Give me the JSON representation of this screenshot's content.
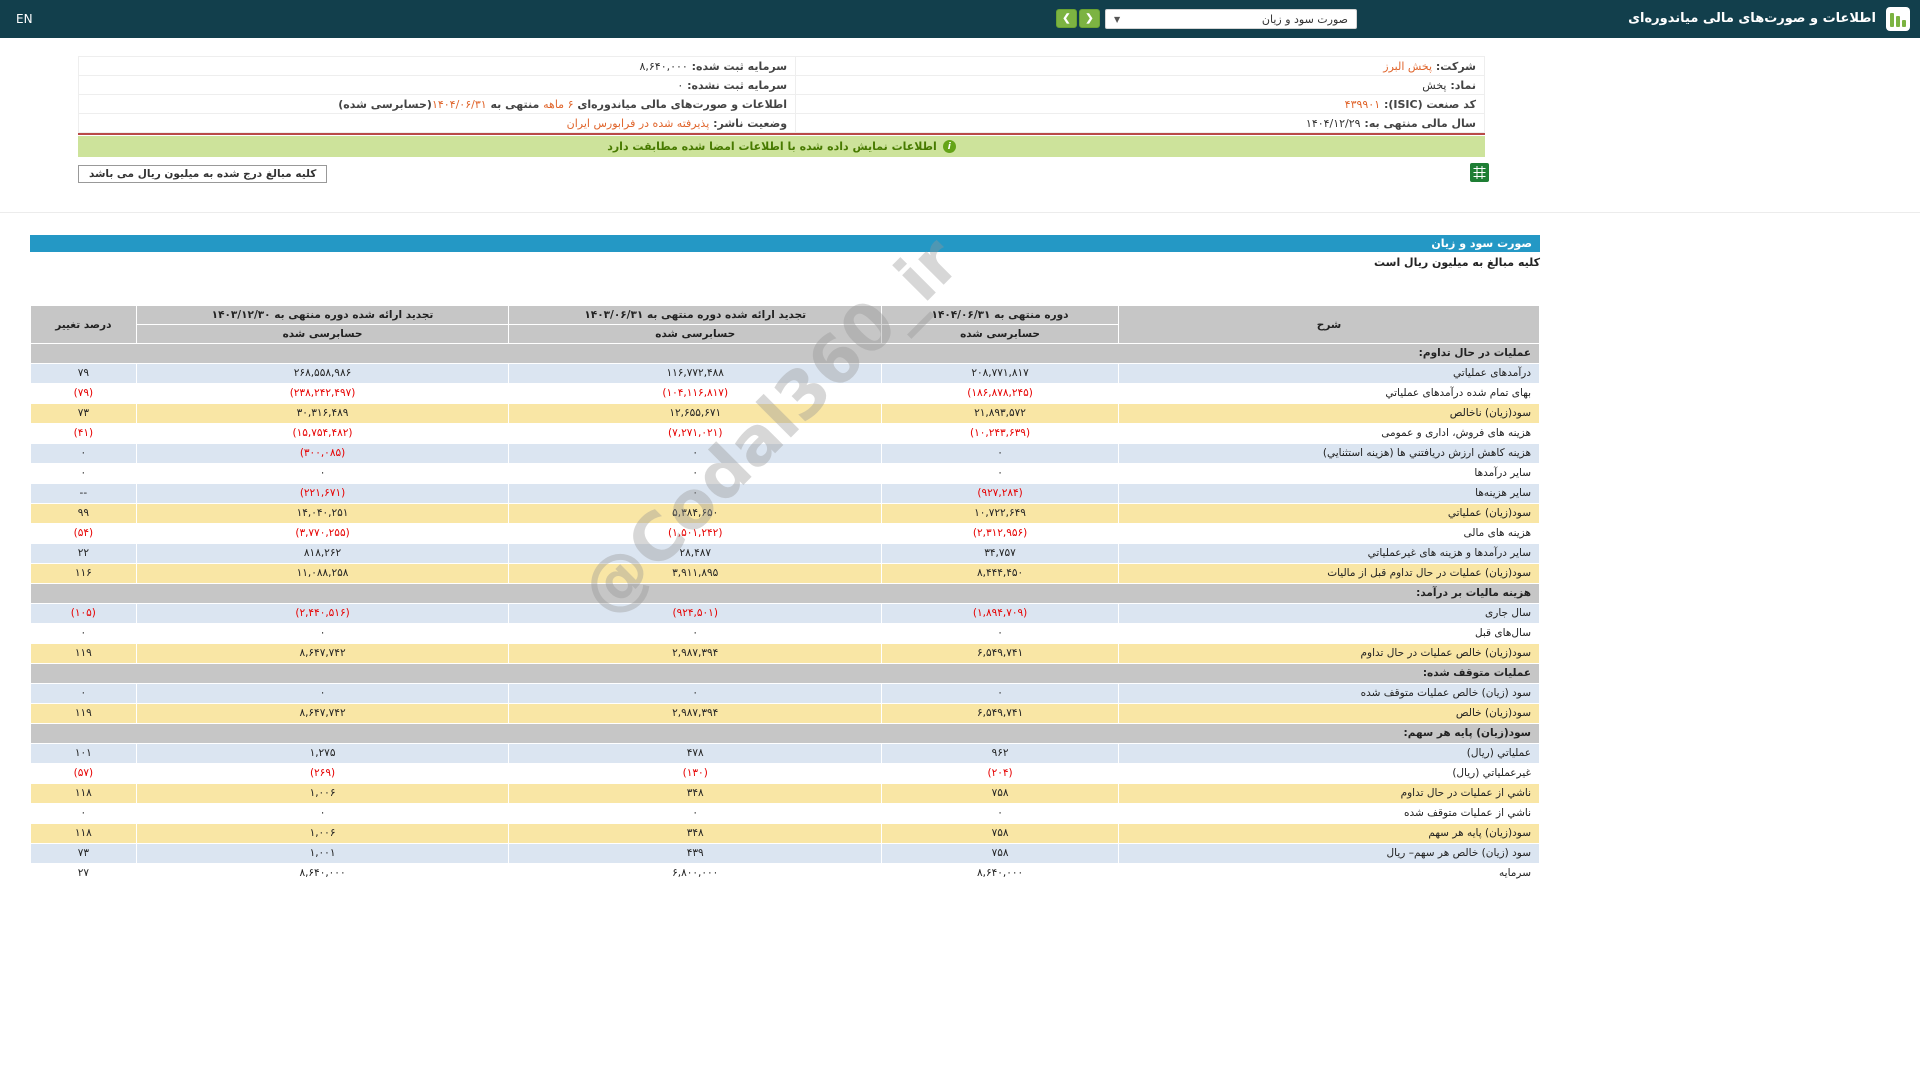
{
  "topbar": {
    "title": "اطلاعات و صورت‌های مالی میاندوره‌ای",
    "dropdown_value": "صورت سود و زیان",
    "prev_label": "❮",
    "next_label": "❯",
    "en_label": "EN"
  },
  "company": {
    "rows": [
      {
        "right": [
          {
            "t": "شرکت:  ",
            "c": "label"
          },
          {
            "t": "پخش البرز",
            "c": "orange",
            "link": true
          }
        ],
        "left": [
          {
            "t": "سرمایه ثبت شده:  ",
            "c": "label"
          },
          {
            "t": "۸,۶۴۰,۰۰۰",
            "c": "dark"
          }
        ]
      },
      {
        "right": [
          {
            "t": "نماد:  ",
            "c": "label"
          },
          {
            "t": "پخش",
            "c": "dark"
          }
        ],
        "left": [
          {
            "t": "سرمایه ثبت نشده:  ",
            "c": "label"
          },
          {
            "t": "۰",
            "c": "dark"
          }
        ]
      },
      {
        "right": [
          {
            "t": "کد صنعت (ISIC):  ",
            "c": "label"
          },
          {
            "t": "۴۳۹۹۰۱",
            "c": "orange"
          }
        ],
        "left": [
          {
            "t": "اطلاعات و صورت‌های مالی میاندوره‌ای ",
            "c": "label"
          },
          {
            "t": "۶ ماهه",
            "c": "orange"
          },
          {
            "t": " منتهی به ",
            "c": "label"
          },
          {
            "t": "۱۴۰۴/۰۶/۳۱",
            "c": "orange"
          },
          {
            "t": "(حسابرسی شده)",
            "c": "label"
          }
        ]
      },
      {
        "right": [
          {
            "t": "سال مالی منتهی به:  ",
            "c": "label"
          },
          {
            "t": "۱۴۰۴/۱۲/۲۹",
            "c": "dark"
          }
        ],
        "left": [
          {
            "t": "وضعیت ناشر:  ",
            "c": "label"
          },
          {
            "t": "پذیرفته شده در فرابورس ایران",
            "c": "orange"
          }
        ]
      }
    ]
  },
  "banner": {
    "icon_glyph": "i",
    "text": "اطلاعات نمایش داده شده با اطلاعات امضا شده مطابقت دارد"
  },
  "amounts_note": "کلیه مبالغ درج شده به میلیون ریال می باشد",
  "statement": {
    "title": "صورت سود و زیان",
    "note": "کلیه مبالغ به میلیون ریال است",
    "header": {
      "desc": "شرح",
      "chg": "درصد تغییر",
      "periods": [
        {
          "title": "دوره منتهی به ۱۴۰۴/۰۶/۳۱",
          "sub": "حسابرسی شده"
        },
        {
          "title": "تجدید ارائه شده دوره منتهی به ۱۴۰۳/۰۶/۳۱",
          "sub": "حسابرسی شده"
        },
        {
          "title": "تجدید ارائه شده دوره منتهی به ۱۴۰۳/۱۲/۳۰",
          "sub": "حسابرسی شده"
        }
      ]
    },
    "rows": [
      {
        "type": "section",
        "desc": "عملیات در حال تداوم:"
      },
      {
        "bg": "blue",
        "desc": "درآمدهای عملیاتي",
        "v": [
          "۲۰۸,۷۷۱,۸۱۷",
          "۱۱۶,۷۷۲,۴۸۸",
          "۲۶۸,۵۵۸,۹۸۶",
          "۷۹"
        ]
      },
      {
        "bg": "white",
        "desc": "بهای تمام شده درآمدهای عملیاتي",
        "v": [
          "(۱۸۶,۸۷۸,۲۴۵)",
          "(۱۰۴,۱۱۶,۸۱۷)",
          "(۲۳۸,۲۴۲,۴۹۷)",
          "(۷۹)"
        ]
      },
      {
        "bg": "yellow",
        "desc": "سود(زیان) ناخالص",
        "v": [
          "۲۱,۸۹۳,۵۷۲",
          "۱۲,۶۵۵,۶۷۱",
          "۳۰,۳۱۶,۴۸۹",
          "۷۳"
        ]
      },
      {
        "bg": "white",
        "desc": "هزینه های فروش، اداری و عمومی",
        "v": [
          "(۱۰,۲۴۳,۶۳۹)",
          "(۷,۲۷۱,۰۲۱)",
          "(۱۵,۷۵۴,۴۸۲)",
          "(۴۱)"
        ]
      },
      {
        "bg": "blue",
        "desc": "هزینه کاهش ارزش دریافتني ها (هزینه استثنایي)",
        "v": [
          "۰",
          "۰",
          "(۳۰۰,۰۸۵)",
          "۰"
        ]
      },
      {
        "bg": "white",
        "desc": "سایر درآمدها",
        "v": [
          "۰",
          "۰",
          "۰",
          "۰"
        ]
      },
      {
        "bg": "blue",
        "desc": "سایر هزینه‌ها",
        "v": [
          "(۹۲۷,۲۸۴)",
          "۰",
          "(۲۲۱,۶۷۱)",
          "--"
        ]
      },
      {
        "bg": "yellow",
        "desc": "سود(زیان) عملیاتي",
        "v": [
          "۱۰,۷۲۲,۶۴۹",
          "۵,۳۸۴,۶۵۰",
          "۱۴,۰۴۰,۲۵۱",
          "۹۹"
        ]
      },
      {
        "bg": "white",
        "desc": "هزینه های مالی",
        "v": [
          "(۲,۳۱۲,۹۵۶)",
          "(۱,۵۰۱,۲۴۲)",
          "(۳,۷۷۰,۲۵۵)",
          "(۵۴)"
        ]
      },
      {
        "bg": "blue",
        "desc": "سایر درآمدها و هزینه های غیرعملیاتي",
        "v": [
          "۳۴,۷۵۷",
          "۲۸,۴۸۷",
          "۸۱۸,۲۶۲",
          "۲۲"
        ]
      },
      {
        "bg": "yellow",
        "desc": "سود(زیان) عملیات در حال تداوم قبل از مالیات",
        "v": [
          "۸,۴۴۴,۴۵۰",
          "۳,۹۱۱,۸۹۵",
          "۱۱,۰۸۸,۲۵۸",
          "۱۱۶"
        ]
      },
      {
        "type": "section",
        "desc": "هزینه مالیات بر درآمد:"
      },
      {
        "bg": "blue",
        "desc": "سال جاری",
        "v": [
          "(۱,۸۹۴,۷۰۹)",
          "(۹۲۴,۵۰۱)",
          "(۲,۴۴۰,۵۱۶)",
          "(۱۰۵)"
        ]
      },
      {
        "bg": "white",
        "desc": "سال‌های قبل",
        "v": [
          "۰",
          "۰",
          "۰",
          "۰"
        ]
      },
      {
        "bg": "yellow",
        "desc": "سود(زیان) خالص عملیات در حال تداوم",
        "v": [
          "۶,۵۴۹,۷۴۱",
          "۲,۹۸۷,۳۹۴",
          "۸,۶۴۷,۷۴۲",
          "۱۱۹"
        ]
      },
      {
        "type": "section",
        "desc": "عملیات متوقف شده:"
      },
      {
        "bg": "blue",
        "desc": "سود (زیان) خالص عملیات متوقف شده",
        "v": [
          "۰",
          "۰",
          "۰",
          "۰"
        ]
      },
      {
        "bg": "yellow",
        "desc": "سود(زیان) خالص",
        "v": [
          "۶,۵۴۹,۷۴۱",
          "۲,۹۸۷,۳۹۴",
          "۸,۶۴۷,۷۴۲",
          "۱۱۹"
        ]
      },
      {
        "type": "section",
        "desc": "سود(زیان) پایه هر سهم:"
      },
      {
        "bg": "blue",
        "desc": "عملیاتي (ریال)",
        "v": [
          "۹۶۲",
          "۴۷۸",
          "۱,۲۷۵",
          "۱۰۱"
        ]
      },
      {
        "bg": "white",
        "desc": "غیرعملیاتي (ریال)",
        "v": [
          "(۲۰۴)",
          "(۱۳۰)",
          "(۲۶۹)",
          "(۵۷)"
        ]
      },
      {
        "bg": "yellow",
        "desc": "ناشي از عملیات در حال تداوم",
        "v": [
          "۷۵۸",
          "۳۴۸",
          "۱,۰۰۶",
          "۱۱۸"
        ]
      },
      {
        "bg": "white",
        "desc": "ناشي از عملیات متوقف شده",
        "v": [
          "۰",
          "۰",
          "۰",
          "۰"
        ]
      },
      {
        "bg": "yellow",
        "desc": "سود(زیان) پایه هر سهم",
        "v": [
          "۷۵۸",
          "۳۴۸",
          "۱,۰۰۶",
          "۱۱۸"
        ]
      },
      {
        "bg": "blue",
        "desc": "سود (زیان) خالص هر سهم– ریال",
        "v": [
          "۷۵۸",
          "۴۳۹",
          "۱,۰۰۱",
          "۷۳"
        ]
      },
      {
        "bg": "white",
        "desc": "سرمایه",
        "v": [
          "۸,۶۴۰,۰۰۰",
          "۶,۸۰۰,۰۰۰",
          "۸,۶۴۰,۰۰۰",
          "۲۷"
        ]
      }
    ]
  },
  "watermark": "@Codal360_ir",
  "colors": {
    "topbar_bg": "#123f4c",
    "green_button": "#7cb342",
    "banner_bg": "#cde39b",
    "banner_text": "#477a00",
    "blue_bar": "#2498c5",
    "row_blue": "#dbe5f1",
    "row_yellow": "#f9e6a5",
    "header_gray": "#c6c6c6",
    "negative": "#e60000",
    "orange_accent": "#e0662d",
    "red_divider": "#b94a48",
    "info_icon": "#64a417"
  }
}
